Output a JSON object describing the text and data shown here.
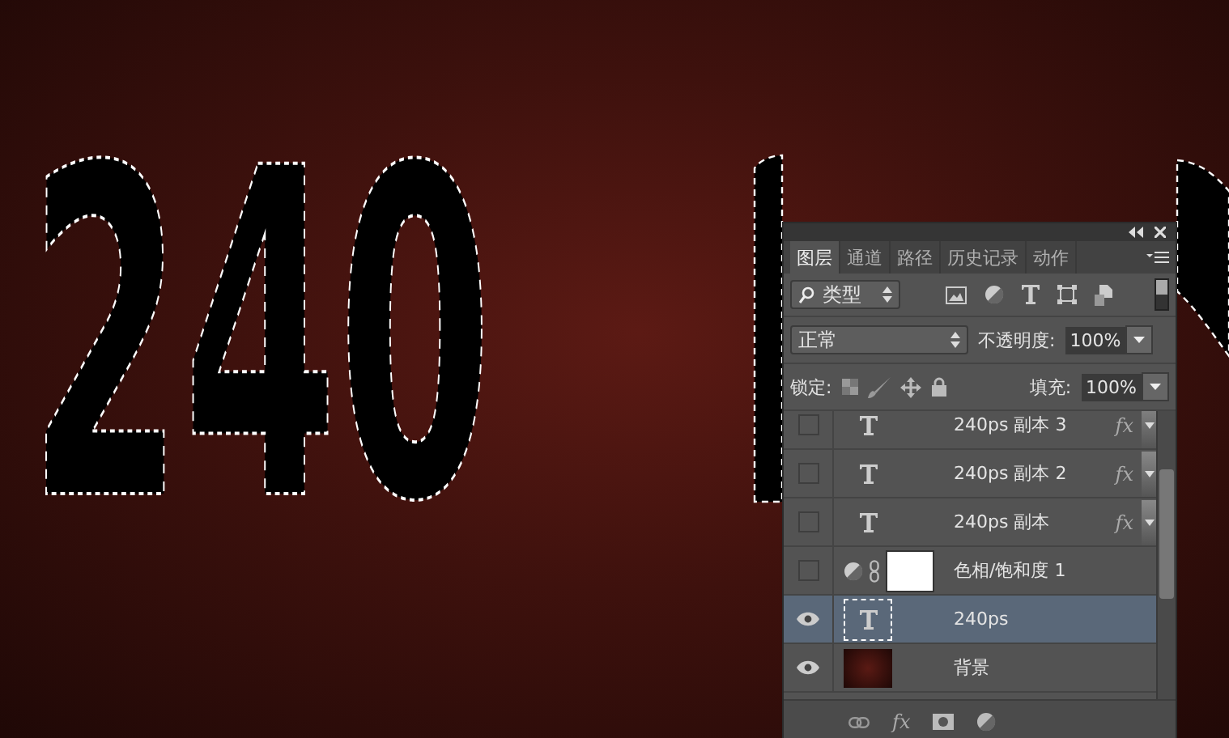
{
  "canvas": {
    "text": "240",
    "selection": true
  },
  "panel": {
    "tabs": [
      {
        "label": "图层",
        "selected": true
      },
      {
        "label": "通道",
        "selected": false
      },
      {
        "label": "路径",
        "selected": false
      },
      {
        "label": "历史记录",
        "selected": false
      },
      {
        "label": "动作",
        "selected": false
      }
    ],
    "filter": {
      "value": "类型"
    },
    "blend_mode": {
      "value": "正常"
    },
    "opacity": {
      "label": "不透明度:",
      "value": "100%"
    },
    "lock": {
      "label": "锁定:"
    },
    "fill": {
      "label": "填充:",
      "value": "100%"
    },
    "layers": [
      {
        "kind": "text",
        "name": "240ps 副本 3",
        "visible": false,
        "selected": false,
        "effects": "fx"
      },
      {
        "kind": "text",
        "name": "240ps 副本 2",
        "visible": false,
        "selected": false,
        "effects": "fx"
      },
      {
        "kind": "text",
        "name": "240ps 副本",
        "visible": false,
        "selected": false,
        "effects": "fx"
      },
      {
        "kind": "adjustment",
        "name": "色相/饱和度 1",
        "visible": false,
        "selected": false
      },
      {
        "kind": "text",
        "name": "240ps",
        "visible": true,
        "selected": true
      },
      {
        "kind": "image",
        "name": "背景",
        "visible": true,
        "selected": false
      }
    ],
    "footer": {
      "effects": "fx"
    }
  }
}
